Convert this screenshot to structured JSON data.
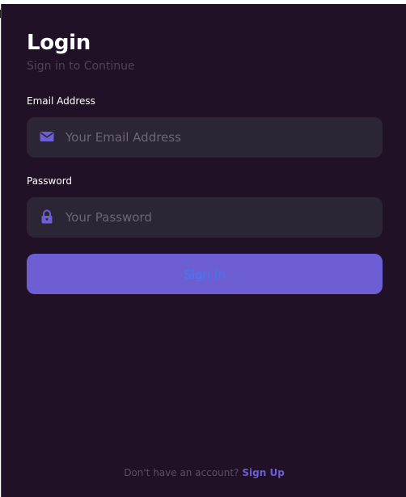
{
  "login": {
    "title": "Login",
    "subtitle": "Sign in to Continue",
    "email": {
      "label": "Email Address",
      "placeholder": "Your Email Address",
      "value": "",
      "icon": "mail-icon"
    },
    "password": {
      "label": "Password",
      "placeholder": "Your Password",
      "value": "",
      "icon": "lock-icon"
    },
    "submit_label": "Sign In",
    "footer_text": "Don't have an account?",
    "signup_label": "Sign Up"
  },
  "colors": {
    "background": "#201126",
    "field_background": "#2c2536",
    "accent": "#6d5fd3",
    "button_text": "#3e7bf0",
    "muted_text": "#4f4359"
  }
}
